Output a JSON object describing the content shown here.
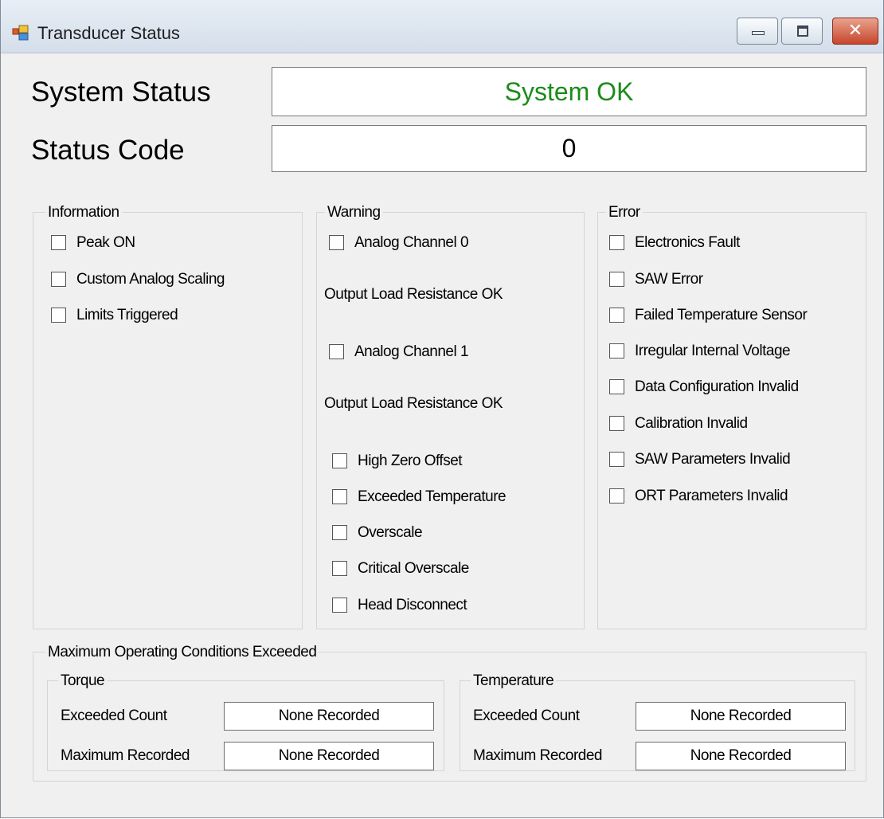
{
  "window": {
    "title": "Transducer Status",
    "controls": {
      "minimize": "minimize",
      "maximize": "maximize",
      "close": "close"
    }
  },
  "colors": {
    "status_ok": "#1a8c1a",
    "panel_bg": "#f0f0f0"
  },
  "system_status": {
    "label": "System Status",
    "value": "System OK"
  },
  "status_code": {
    "label": "Status Code",
    "value": "0"
  },
  "information": {
    "title": "Information",
    "items": [
      {
        "label": "Peak ON",
        "checked": false
      },
      {
        "label": "Custom Analog Scaling",
        "checked": false
      },
      {
        "label": "Limits Triggered",
        "checked": false
      }
    ]
  },
  "warning": {
    "title": "Warning",
    "channel0": {
      "label": "Analog Channel 0",
      "checked": false,
      "status": "Output Load Resistance OK"
    },
    "channel1": {
      "label": "Analog Channel 1",
      "checked": false,
      "status": "Output Load Resistance OK"
    },
    "items": [
      {
        "label": "High Zero Offset",
        "checked": false
      },
      {
        "label": "Exceeded Temperature",
        "checked": false
      },
      {
        "label": "Overscale",
        "checked": false
      },
      {
        "label": "Critical Overscale",
        "checked": false
      },
      {
        "label": "Head Disconnect",
        "checked": false
      }
    ]
  },
  "error": {
    "title": "Error",
    "items": [
      {
        "label": "Electronics Fault",
        "checked": false
      },
      {
        "label": "SAW Error",
        "checked": false
      },
      {
        "label": "Failed Temperature Sensor",
        "checked": false
      },
      {
        "label": "Irregular Internal Voltage",
        "checked": false
      },
      {
        "label": "Data Configuration Invalid",
        "checked": false
      },
      {
        "label": "Calibration Invalid",
        "checked": false
      },
      {
        "label": "SAW Parameters Invalid",
        "checked": false
      },
      {
        "label": "ORT Parameters Invalid",
        "checked": false
      }
    ]
  },
  "max_conditions": {
    "title": "Maximum Operating Conditions Exceeded",
    "torque": {
      "title": "Torque",
      "exceeded_count_label": "Exceeded Count",
      "exceeded_count_value": "None Recorded",
      "max_recorded_label": "Maximum Recorded",
      "max_recorded_value": "None Recorded"
    },
    "temperature": {
      "title": "Temperature",
      "exceeded_count_label": "Exceeded Count",
      "exceeded_count_value": "None Recorded",
      "max_recorded_label": "Maximum Recorded",
      "max_recorded_value": "None Recorded"
    }
  }
}
